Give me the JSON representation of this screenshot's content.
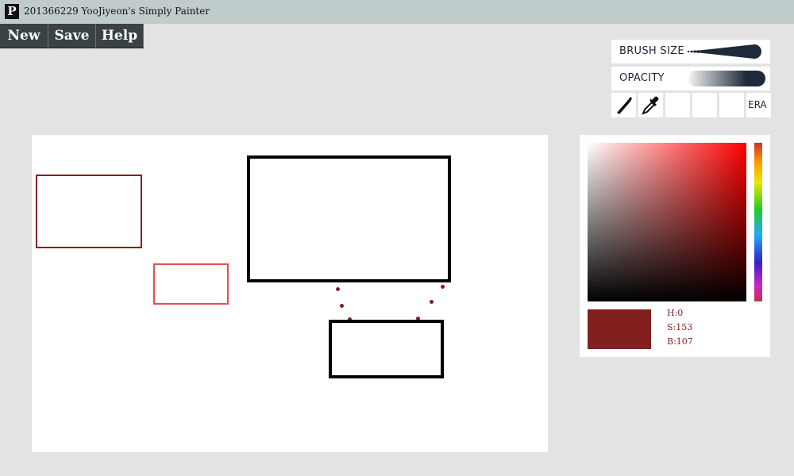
{
  "window": {
    "icon_letter": "P",
    "title": "201366229 YooJiyeon's Simply Painter"
  },
  "menu": {
    "new_label": "New",
    "save_label": "Save",
    "help_label": "Help"
  },
  "brush_panel": {
    "brush_size_label": "BRUSH SIZE",
    "opacity_label": "OPACITY",
    "tools": {
      "brush_icon": "brush-icon",
      "eyedropper_icon": "eyedropper-icon",
      "eraser_label": "ERA"
    }
  },
  "color_picker": {
    "selected_color": "#822020",
    "h": "H:0",
    "s": "S:153",
    "b": "B:107"
  },
  "colors": {
    "titlebar": "#c0cccc",
    "menu_button": "#3a4246",
    "slider": "#1e2a3a",
    "dark_red": "#822020",
    "light_red": "#e05050"
  }
}
